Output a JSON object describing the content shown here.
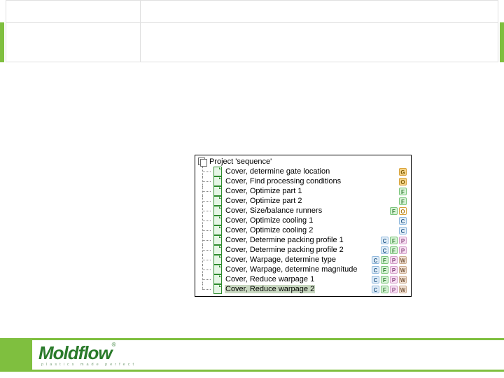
{
  "project": {
    "title": "Project 'sequence'",
    "items": [
      {
        "label": "Cover, determine gate location",
        "badges": [
          "G"
        ]
      },
      {
        "label": "Cover, Find processing conditions",
        "badges": [
          "O"
        ]
      },
      {
        "label": "Cover, Optimize part 1",
        "badges": [
          "F"
        ]
      },
      {
        "label": "Cover, Optimize part 2",
        "badges": [
          "F"
        ]
      },
      {
        "label": "Cover, Size/balance runners",
        "badges": [
          "F",
          "O-outline"
        ]
      },
      {
        "label": "Cover, Optimize cooling 1",
        "badges": [
          "C"
        ]
      },
      {
        "label": "Cover, Optimize cooling 2",
        "badges": [
          "C"
        ]
      },
      {
        "label": "Cover, Determine packing profile 1",
        "badges": [
          "C",
          "F",
          "P"
        ]
      },
      {
        "label": "Cover, Determine packing profile 2",
        "badges": [
          "C",
          "F",
          "P"
        ]
      },
      {
        "label": "Cover, Warpage, determine type",
        "badges": [
          "C",
          "F",
          "P",
          "W"
        ]
      },
      {
        "label": "Cover, Warpage, determine magnitude",
        "badges": [
          "C",
          "F",
          "P",
          "W"
        ]
      },
      {
        "label": "Cover, Reduce warpage 1",
        "badges": [
          "C",
          "F",
          "P",
          "W"
        ]
      },
      {
        "label": "Cover, Reduce warpage 2",
        "badges": [
          "C",
          "F",
          "P",
          "W"
        ],
        "selected": true
      }
    ]
  },
  "badge_letters": {
    "G": "G",
    "O": "O",
    "O-outline": "O",
    "F": "F",
    "C": "C",
    "P": "P",
    "W": "W"
  },
  "logo": {
    "brand": "Moldflow",
    "reg": "®",
    "tagline": "plastics made perfect"
  }
}
